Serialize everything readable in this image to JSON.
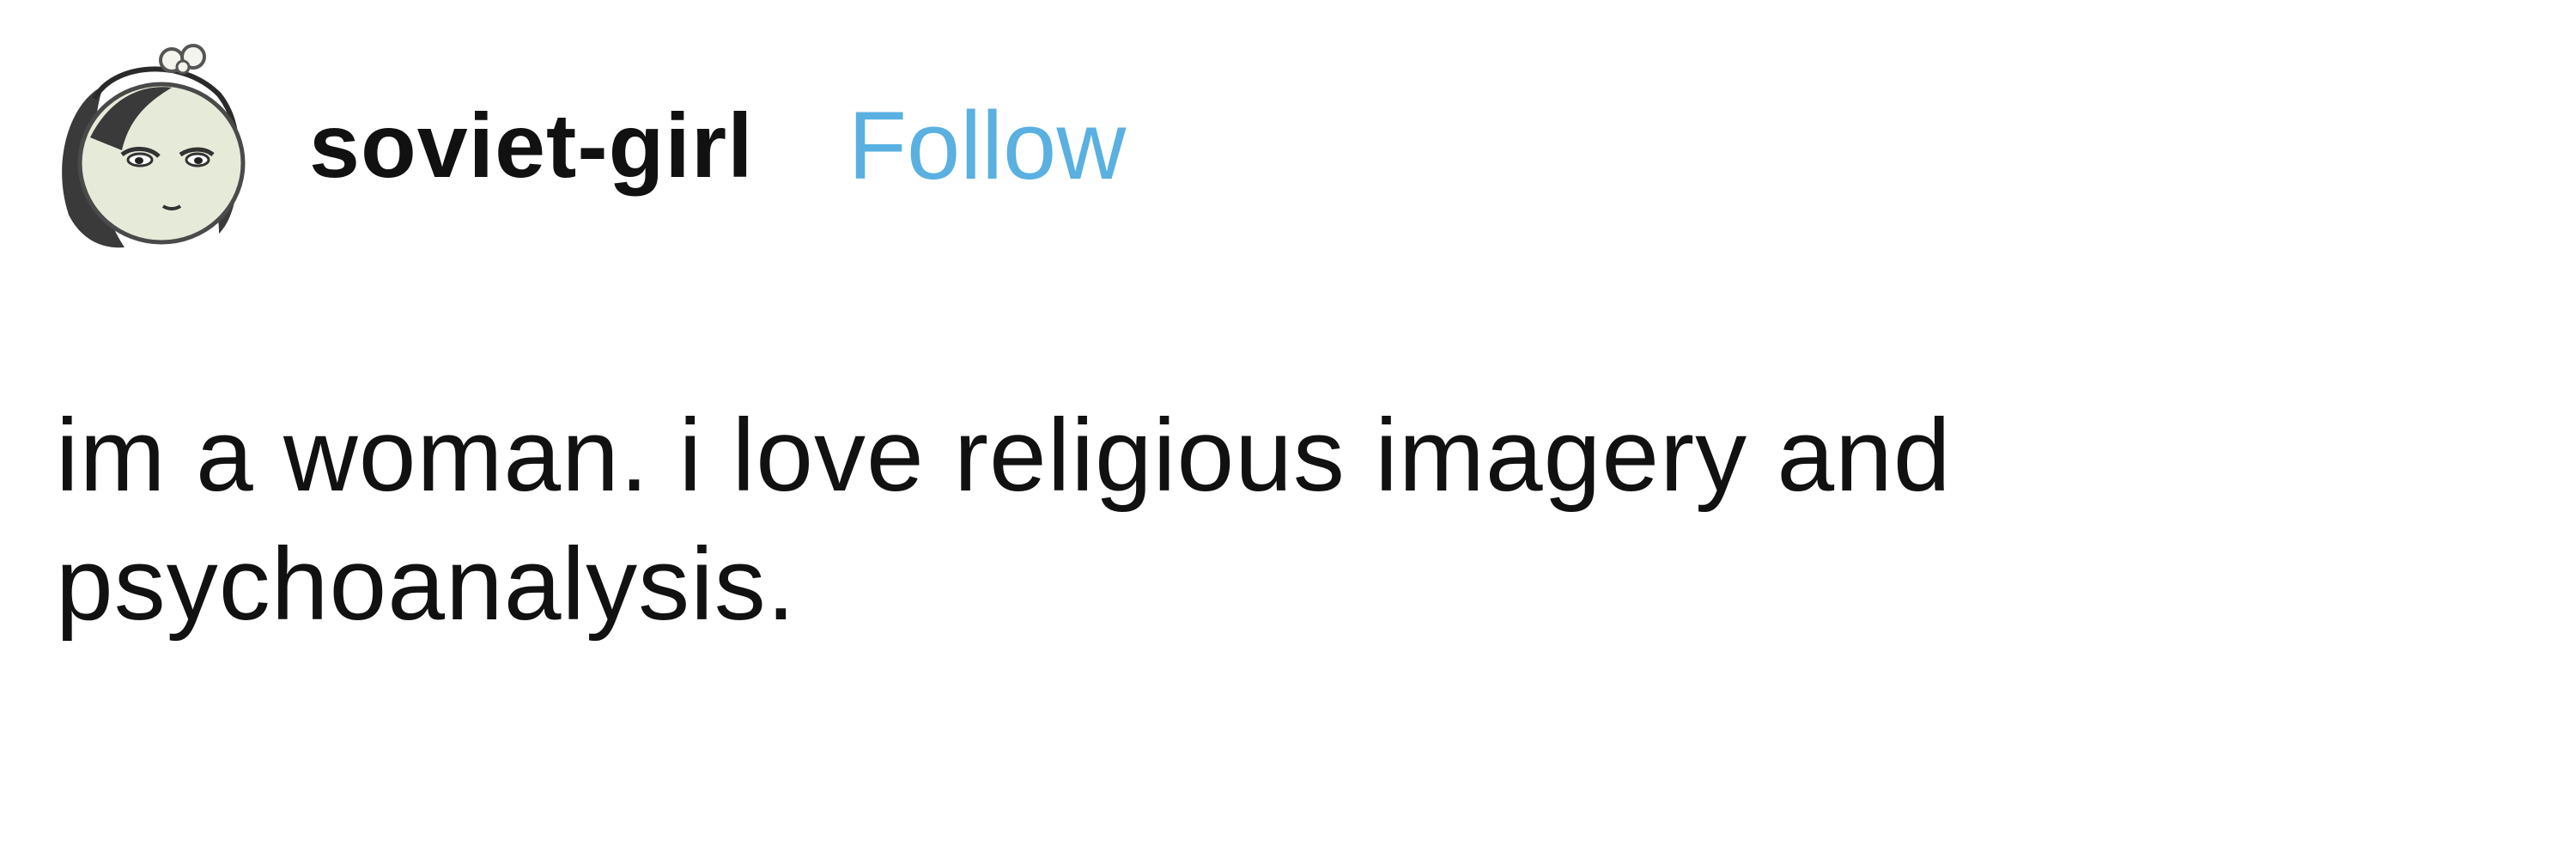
{
  "post": {
    "username": "soviet-girl",
    "follow_label": "Follow",
    "avatar_icon": "cartoon-girl-avatar-icon",
    "text": "im a woman. i love religious imagery and psychoanalysis."
  },
  "colors": {
    "follow": "#5ab0e0",
    "text": "#111111",
    "background": "#ffffff"
  }
}
